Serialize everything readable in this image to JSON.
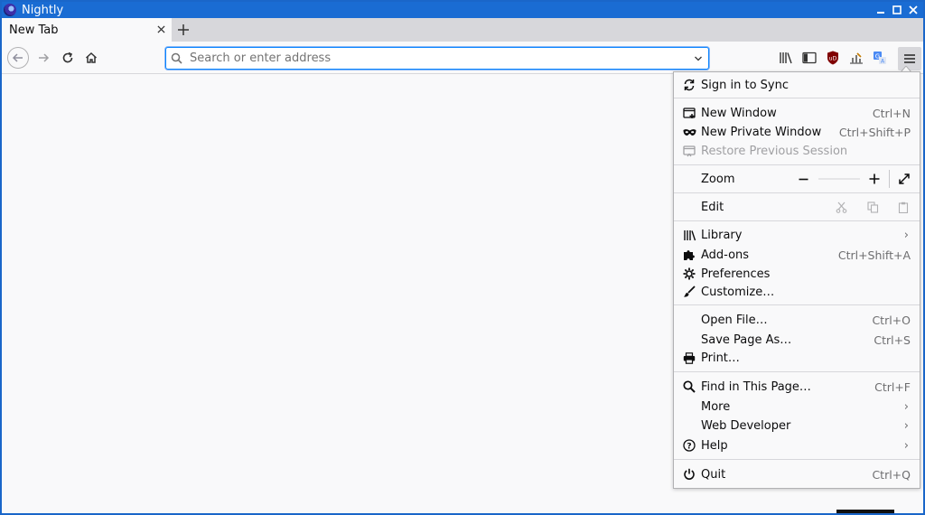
{
  "window": {
    "title": "Nightly",
    "controls": [
      "minimize-icon",
      "maximize-icon",
      "close-icon"
    ]
  },
  "tabs": [
    {
      "label": "New Tab",
      "active": true
    }
  ],
  "urlbar": {
    "placeholder": "Search or enter address",
    "value": ""
  },
  "toolbar_icons": [
    "library-icon",
    "sidebar-icon",
    "ublock-icon",
    "chart-icon",
    "translate-icon",
    "hamburger-menu-icon"
  ],
  "menu": {
    "sync": {
      "label": "Sign in to Sync"
    },
    "new_window": {
      "label": "New Window",
      "shortcut": "Ctrl+N"
    },
    "new_private": {
      "label": "New Private Window",
      "shortcut": "Ctrl+Shift+P"
    },
    "restore": {
      "label": "Restore Previous Session",
      "disabled": true
    },
    "zoom": {
      "label": "Zoom"
    },
    "edit": {
      "label": "Edit"
    },
    "library": {
      "label": "Library"
    },
    "addons": {
      "label": "Add-ons",
      "shortcut": "Ctrl+Shift+A"
    },
    "preferences": {
      "label": "Preferences"
    },
    "customize": {
      "label": "Customize…"
    },
    "open_file": {
      "label": "Open File…",
      "shortcut": "Ctrl+O"
    },
    "save_page": {
      "label": "Save Page As…",
      "shortcut": "Ctrl+S"
    },
    "print": {
      "label": "Print…"
    },
    "find": {
      "label": "Find in This Page…",
      "shortcut": "Ctrl+F"
    },
    "more": {
      "label": "More"
    },
    "web_developer": {
      "label": "Web Developer"
    },
    "help": {
      "label": "Help"
    },
    "quit": {
      "label": "Quit",
      "shortcut": "Ctrl+Q"
    }
  },
  "colors": {
    "titlebar": "#1a6cd3",
    "accent": "#0a84ff",
    "menu_bg": "#f9f9fa"
  }
}
